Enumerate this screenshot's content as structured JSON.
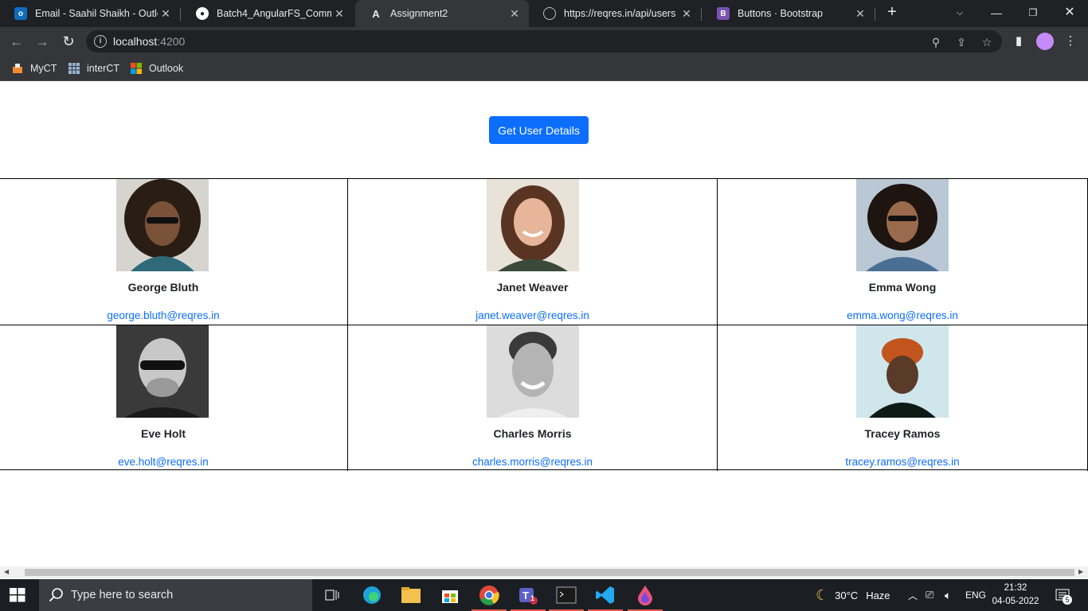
{
  "browser": {
    "tabs": [
      {
        "title": "Email - Saahil Shaikh - Outlo",
        "favicon": "outlook-icon"
      },
      {
        "title": "Batch4_AngularFS_CommonI",
        "favicon": "github-icon"
      },
      {
        "title": "Assignment2",
        "favicon": "angular-icon",
        "active": true
      },
      {
        "title": "https://reqres.in/api/users",
        "favicon": "globe-icon"
      },
      {
        "title": "Buttons · Bootstrap",
        "favicon": "bootstrap-icon"
      }
    ],
    "url_host": "localhost",
    "url_port": ":4200",
    "bookmarks": [
      {
        "label": "MyCT"
      },
      {
        "label": "interCT"
      },
      {
        "label": "Outlook"
      }
    ]
  },
  "page": {
    "get_button_label": "Get User Details",
    "users": [
      {
        "name": "George Bluth",
        "email": "george.bluth@reqres.in"
      },
      {
        "name": "Janet Weaver",
        "email": "janet.weaver@reqres.in"
      },
      {
        "name": "Emma Wong",
        "email": "emma.wong@reqres.in"
      },
      {
        "name": "Eve Holt",
        "email": "eve.holt@reqres.in"
      },
      {
        "name": "Charles Morris",
        "email": "charles.morris@reqres.in"
      },
      {
        "name": "Tracey Ramos",
        "email": "tracey.ramos@reqres.in"
      }
    ]
  },
  "taskbar": {
    "search_placeholder": "Type here to search",
    "weather_temp": "30°C",
    "weather_desc": "Haze",
    "language": "ENG",
    "time": "21:32",
    "date": "04-05-2022",
    "notification_count": "5",
    "teams_badge": "1"
  },
  "colors": {
    "primary_button": "#0d6efd",
    "link": "#0d6efd",
    "chrome_dark": "#202124",
    "chrome_toolbar": "#35363a"
  }
}
